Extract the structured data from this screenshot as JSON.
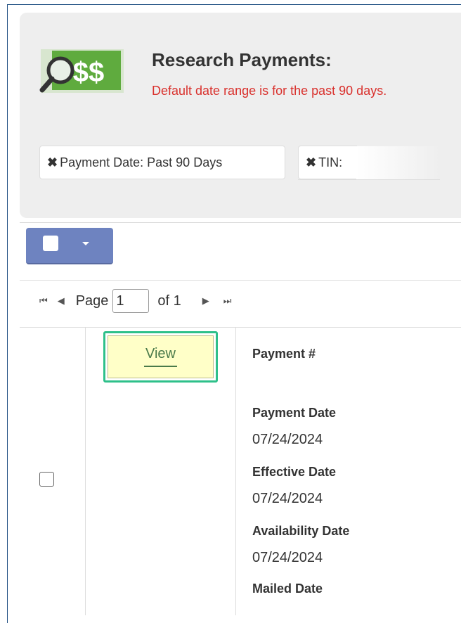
{
  "header": {
    "title": "Research Payments:",
    "subtitle": "Default date range is for the past 90 days."
  },
  "filters": [
    {
      "label": "Payment Date: Past 90 Days"
    },
    {
      "label": "TIN:"
    }
  ],
  "icons": {
    "remove": "✖",
    "logo_text": "$$",
    "first": "⏮",
    "prev": "◀",
    "next": "▶",
    "last": "⏭"
  },
  "pager": {
    "page_label": "Page",
    "page_value": "1",
    "of_label": "of 1"
  },
  "row": {
    "view_label": "View",
    "fields": [
      {
        "label": "Payment #",
        "value": ""
      },
      {
        "label": "Payment Date",
        "value": "07/24/2024"
      },
      {
        "label": "Effective Date",
        "value": "07/24/2024"
      },
      {
        "label": "Availability Date",
        "value": "07/24/2024"
      },
      {
        "label": "Mailed Date",
        "value": ""
      }
    ]
  },
  "colors": {
    "accent_green": "#2ec08a",
    "select_button": "#6e83c0",
    "subtitle_red": "#d9302c",
    "logo_green": "#5fab3e"
  }
}
